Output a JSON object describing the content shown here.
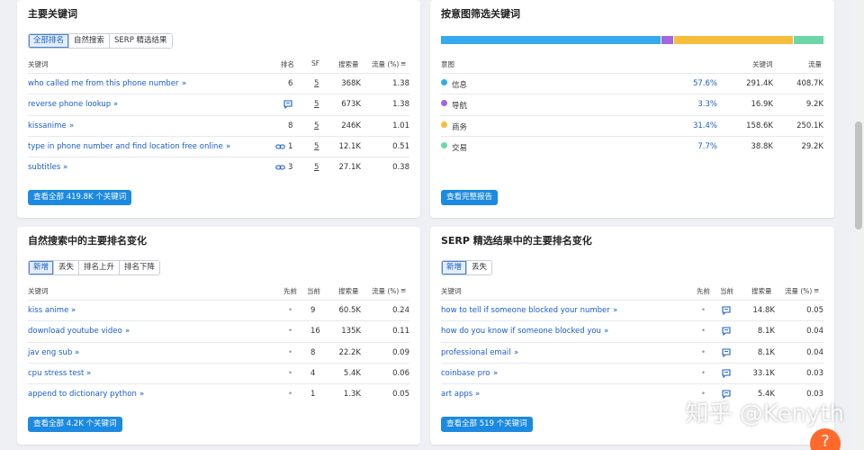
{
  "main_keywords": {
    "title": "主要关键词",
    "tabs": [
      "全部排名",
      "自然搜索",
      "SERP 精选结果"
    ],
    "headers": {
      "keyword": "关键词",
      "rank": "排名",
      "sf": "SF",
      "volume": "搜索量",
      "traffic": "流量 (%)"
    },
    "rows": [
      {
        "keyword": "who called me from this phone number",
        "rank": "6",
        "sf": "5",
        "volume": "368K",
        "traffic": "1.38",
        "icon": ""
      },
      {
        "keyword": "reverse phone lookup",
        "rank": "",
        "sf": "5",
        "volume": "673K",
        "traffic": "1.38",
        "icon": "comment-icon"
      },
      {
        "keyword": "kissanime",
        "rank": "8",
        "sf": "5",
        "volume": "246K",
        "traffic": "1.01",
        "icon": ""
      },
      {
        "keyword": "type in phone number and find location free online",
        "rank": "1",
        "sf": "5",
        "volume": "12.1K",
        "traffic": "0.51",
        "icon": "link-icon"
      },
      {
        "keyword": "subtitles",
        "rank": "3",
        "sf": "5",
        "volume": "27.1K",
        "traffic": "0.38",
        "icon": "link-icon"
      }
    ],
    "button": "查看全部 419.8K 个关键词"
  },
  "intent": {
    "title": "按意图筛选关键词",
    "headers": {
      "intent": "意图",
      "keywords": "关键词",
      "traffic": "流量"
    },
    "rows": [
      {
        "name": "信息",
        "color": "#35aaf0",
        "pct": "57.6%",
        "keywords": "291.4K",
        "traffic": "408.7K",
        "share": 57.6
      },
      {
        "name": "导航",
        "color": "#a166e0",
        "pct": "3.3%",
        "keywords": "16.9K",
        "traffic": "9.2K",
        "share": 3.3
      },
      {
        "name": "商务",
        "color": "#f7bd3c",
        "pct": "31.4%",
        "keywords": "158.6K",
        "traffic": "250.1K",
        "share": 31.4
      },
      {
        "name": "交易",
        "color": "#6dd6a6",
        "pct": "7.7%",
        "keywords": "38.8K",
        "traffic": "29.2K",
        "share": 7.7
      }
    ],
    "button": "查看完整报告"
  },
  "organic_changes": {
    "title": "自然搜索中的主要排名变化",
    "tabs": [
      "新增",
      "丢失",
      "排名上升",
      "排名下降"
    ],
    "headers": {
      "keyword": "关键词",
      "prev": "先前",
      "current": "当前",
      "volume": "搜索量",
      "traffic": "流量 (%)"
    },
    "rows": [
      {
        "keyword": "kiss anime",
        "prev": "•",
        "current": "9",
        "volume": "60.5K",
        "traffic": "0.24"
      },
      {
        "keyword": "download youtube video",
        "prev": "•",
        "current": "16",
        "volume": "135K",
        "traffic": "0.11"
      },
      {
        "keyword": "jav eng sub",
        "prev": "•",
        "current": "8",
        "volume": "22.2K",
        "traffic": "0.09"
      },
      {
        "keyword": "cpu stress test",
        "prev": "•",
        "current": "4",
        "volume": "5.4K",
        "traffic": "0.06"
      },
      {
        "keyword": "append to dictionary python",
        "prev": "•",
        "current": "1",
        "volume": "1.3K",
        "traffic": "0.05"
      }
    ],
    "button": "查看全部 4.2K 个关键词"
  },
  "serp_changes": {
    "title": "SERP 精选结果中的主要排名变化",
    "tabs": [
      "新增",
      "丢失"
    ],
    "headers": {
      "keyword": "关键词",
      "prev": "先前",
      "current": "当前",
      "volume": "搜索量",
      "traffic": "流量 (%)"
    },
    "rows": [
      {
        "keyword": "how to tell if someone blocked your number",
        "prev": "•",
        "volume": "14.8K",
        "traffic": "0.05"
      },
      {
        "keyword": "how do you know if someone blocked you",
        "prev": "•",
        "volume": "8.1K",
        "traffic": "0.04"
      },
      {
        "keyword": "professional email",
        "prev": "•",
        "volume": "8.1K",
        "traffic": "0.04"
      },
      {
        "keyword": "coinbase pro",
        "prev": "•",
        "volume": "33.1K",
        "traffic": "0.03"
      },
      {
        "keyword": "art apps",
        "prev": "•",
        "volume": "5.4K",
        "traffic": "0.03"
      }
    ],
    "button": "查看全部 519 个关键词"
  },
  "watermark": "知乎 @Kenyth",
  "help_label": "?"
}
